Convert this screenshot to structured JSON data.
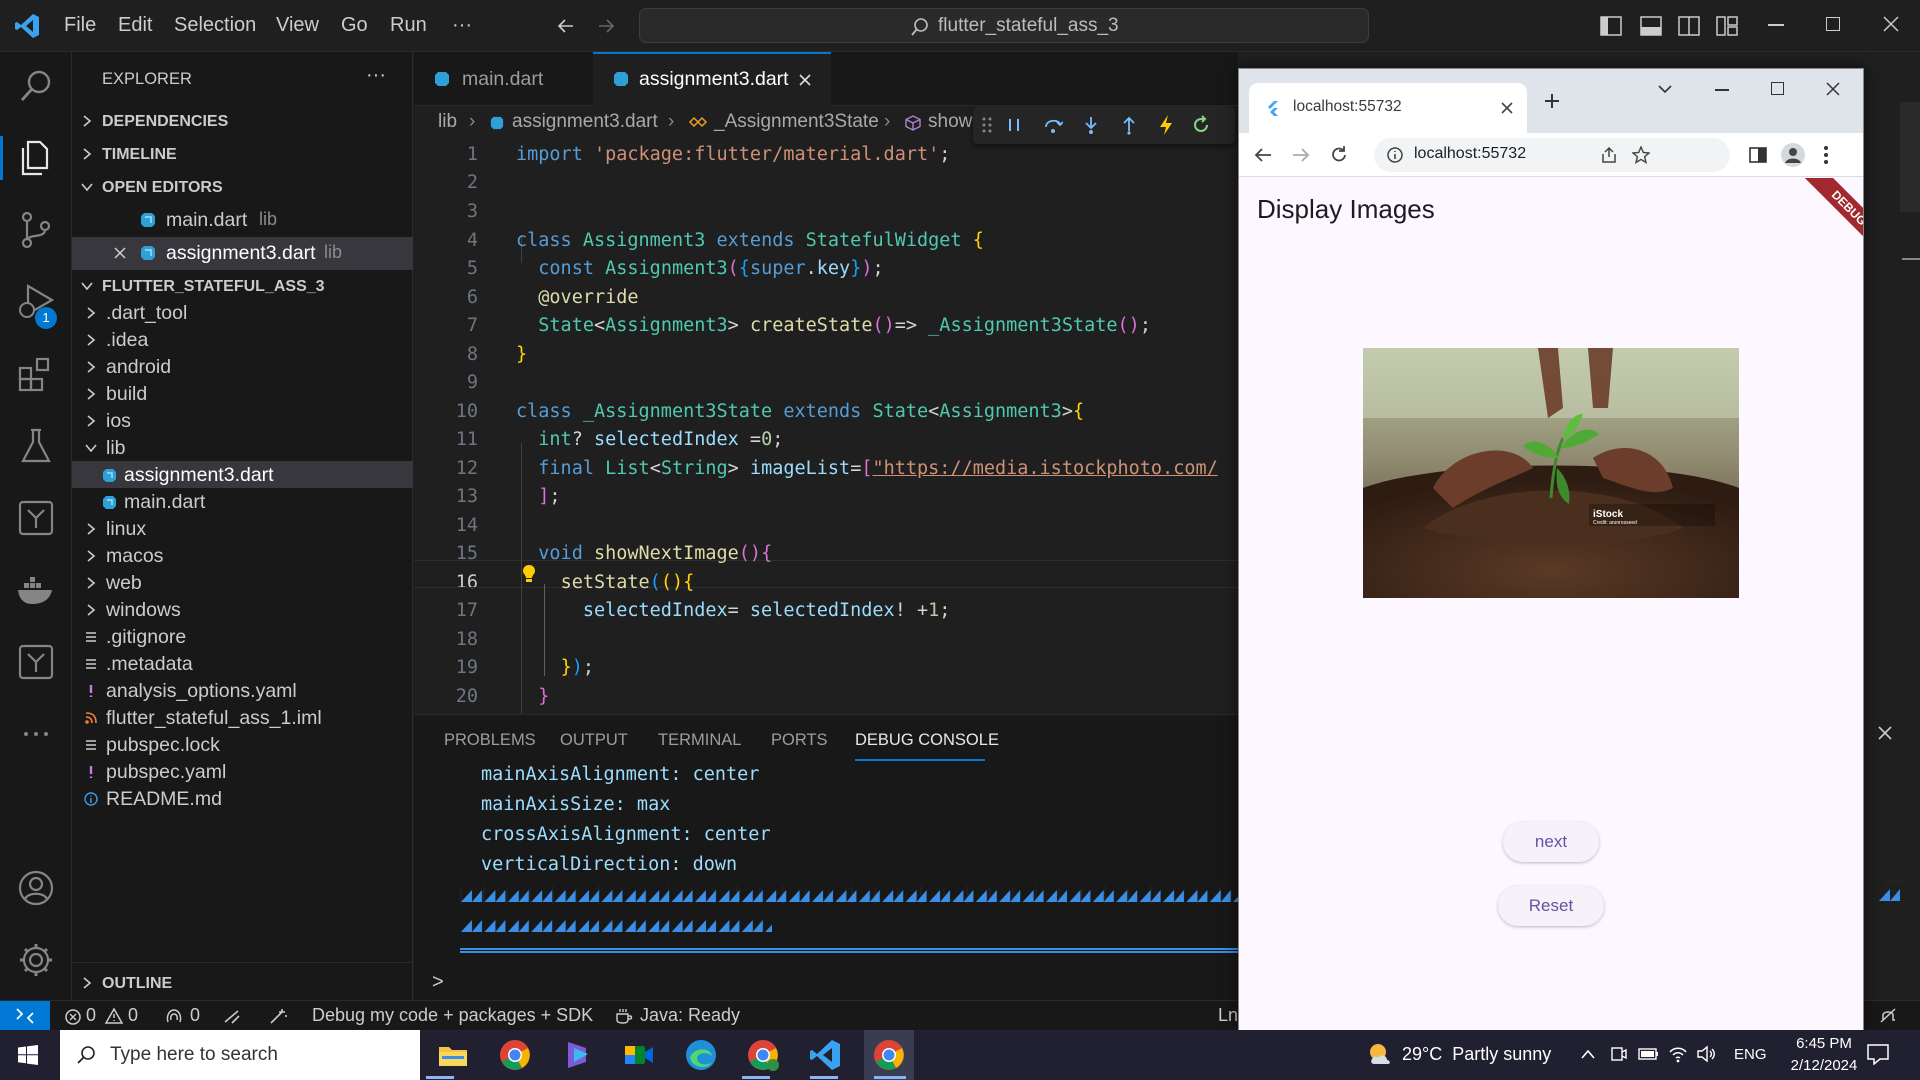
{
  "titlebar": {
    "menu": [
      "File",
      "Edit",
      "Selection",
      "View",
      "Go",
      "Run",
      "···"
    ],
    "search_text": "flutter_stateful_ass_3"
  },
  "activity_badge": "1",
  "explorer": {
    "title": "EXPLORER",
    "more": "···",
    "sections": {
      "dependencies": "DEPENDENCIES",
      "timeline": "TIMELINE",
      "open_editors": "OPEN EDITORS",
      "project": "FLUTTER_STATEFUL_ASS_3",
      "outline": "OUTLINE"
    },
    "open_editors": [
      {
        "name": "main.dart",
        "dir": "lib"
      },
      {
        "name": "assignment3.dart",
        "dir": "lib"
      }
    ],
    "tree": [
      {
        "name": ".dart_tool",
        "kind": "folder"
      },
      {
        "name": ".idea",
        "kind": "folder"
      },
      {
        "name": "android",
        "kind": "folder"
      },
      {
        "name": "build",
        "kind": "folder"
      },
      {
        "name": "ios",
        "kind": "folder"
      },
      {
        "name": "lib",
        "kind": "folder-open"
      },
      {
        "name": "assignment3.dart",
        "kind": "dart"
      },
      {
        "name": "main.dart",
        "kind": "dart"
      },
      {
        "name": "linux",
        "kind": "folder"
      },
      {
        "name": "macos",
        "kind": "folder"
      },
      {
        "name": "web",
        "kind": "folder"
      },
      {
        "name": "windows",
        "kind": "folder"
      },
      {
        "name": ".gitignore",
        "kind": "lines"
      },
      {
        "name": ".metadata",
        "kind": "lines"
      },
      {
        "name": "analysis_options.yaml",
        "kind": "yaml"
      },
      {
        "name": "flutter_stateful_ass_1.iml",
        "kind": "rss"
      },
      {
        "name": "pubspec.lock",
        "kind": "lines"
      },
      {
        "name": "pubspec.yaml",
        "kind": "yaml"
      },
      {
        "name": "README.md",
        "kind": "info"
      }
    ]
  },
  "tabs": [
    {
      "label": "main.dart",
      "active": false
    },
    {
      "label": "assignment3.dart",
      "active": true
    }
  ],
  "breadcrumb": {
    "root": "lib",
    "file": "assignment3.dart",
    "cls": "_Assignment3State",
    "member": "show"
  },
  "code_lines": [
    "1",
    "2",
    "3",
    "4",
    "5",
    "6",
    "7",
    "8",
    "9",
    "10",
    "11",
    "12",
    "13",
    "14",
    "15",
    "16",
    "17",
    "18",
    "19",
    "20"
  ],
  "panel": {
    "tabs": [
      "PROBLEMS",
      "OUTPUT",
      "TERMINAL",
      "PORTS",
      "DEBUG CONSOLE"
    ],
    "console": [
      "mainAxisAlignment: center",
      "mainAxisSize: max",
      "crossAxisAlignment: center",
      "verticalDirection: down"
    ],
    "prompt": ">"
  },
  "status": {
    "errors": "0",
    "warnings": "0",
    "ports": "0",
    "debug": "Debug my code + packages + SDK",
    "java": "Java: Ready",
    "ln": "Ln"
  },
  "browser": {
    "tab_title": "localhost:55732",
    "url": "localhost:55732",
    "app_title": "Display Images",
    "debug_banner": "DEBUG",
    "image_watermark": "iStock",
    "image_credit": "Credit: arunrosseed",
    "buttons": {
      "next": "next",
      "reset": "Reset"
    }
  },
  "taskbar": {
    "search_placeholder": "Type here to search",
    "weather": "29°C  Partly sunny",
    "lang": "ENG",
    "time": "6:45 PM",
    "date": "2/12/2024"
  }
}
